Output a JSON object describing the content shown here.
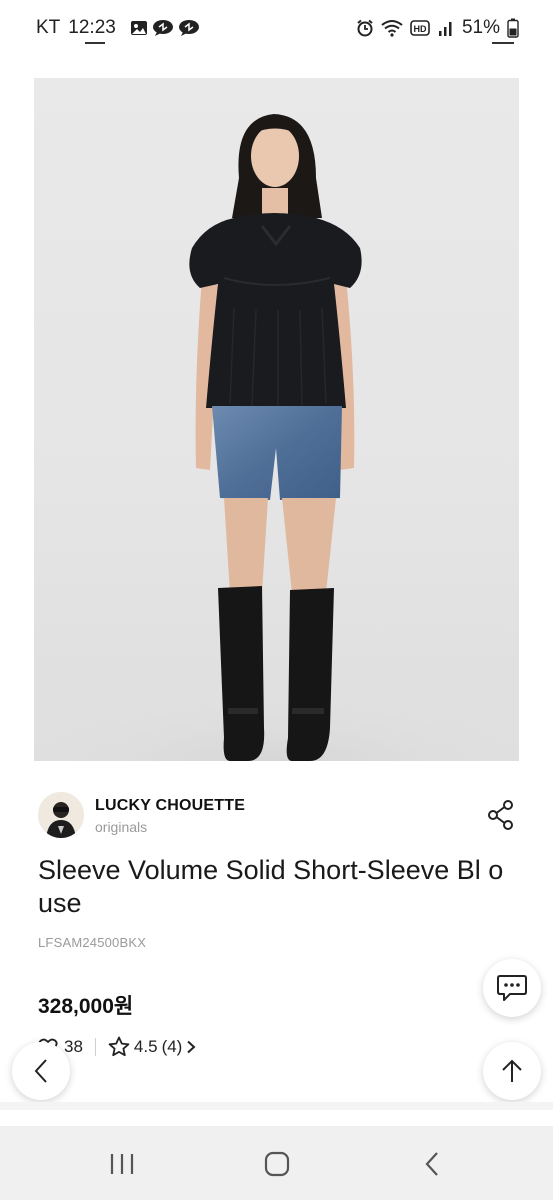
{
  "status_bar": {
    "carrier": "KT",
    "time": "12:23",
    "battery": "51%",
    "left_icons": [
      "image-icon",
      "chat-bubble-icon",
      "chat-bubble-icon"
    ],
    "right_icons": [
      "alarm-icon",
      "wifi-icon",
      "hd-icon",
      "signal-icon",
      "battery-icon"
    ]
  },
  "product": {
    "image_alt_icon": "product-photo",
    "brand": {
      "name": "LUCKY CHOUETTE",
      "sub": "originals"
    },
    "title": "Sleeve Volume Solid Short-Sleeve Bl ouse",
    "code": "LFSAM24500BKX",
    "price": "328,000원",
    "likes": "38",
    "rating": "4.5",
    "review_count": "(4)"
  },
  "colors": {
    "accent": "#111111",
    "muted_text": "#9a9a9a",
    "nav_bg": "#f0f0f0"
  }
}
